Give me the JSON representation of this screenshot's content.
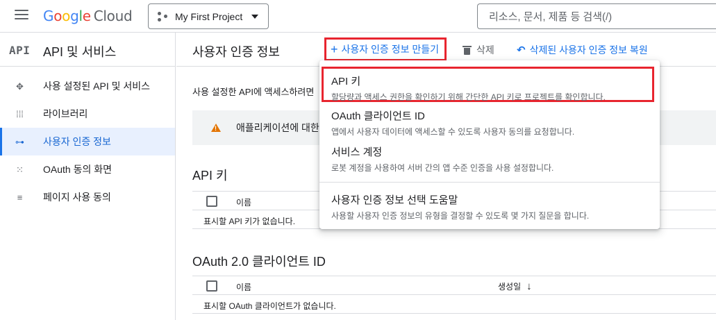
{
  "header": {
    "logo_letters": [
      "G",
      "o",
      "o",
      "g",
      "l",
      "e"
    ],
    "logo_suffix": "Cloud",
    "project_name": "My First Project",
    "search_placeholder": "리소스, 문서, 제품 등 검색(/)"
  },
  "sidebar": {
    "badge": "API",
    "title": "API 및 서비스",
    "items": [
      {
        "label": "사용 설정된 API 및 서비스",
        "icon": "dashboard-icon"
      },
      {
        "label": "라이브러리",
        "icon": "library-icon"
      },
      {
        "label": "사용자 인증 정보",
        "icon": "key-icon",
        "active": true
      },
      {
        "label": "OAuth 동의 화면",
        "icon": "oauth-icon"
      },
      {
        "label": "페이지 사용 동의",
        "icon": "page-settings-icon"
      }
    ]
  },
  "main": {
    "title": "사용자 인증 정보",
    "create_label": "사용자 인증 정보 만들기",
    "delete_label": "삭제",
    "restore_label": "삭제된 사용자 인증 정보 복원",
    "intro": "사용 설정한 API에 액세스하려면",
    "warning": "애플리케이션에 대한",
    "api_keys": {
      "title": "API 키",
      "col_name": "이름",
      "empty": "표시할 API 키가 없습니다."
    },
    "oauth": {
      "title": "OAuth 2.0 클라이언트 ID",
      "col_name": "이름",
      "col_created": "생성일",
      "empty": "표시할 OAuth 클라이언트가 없습니다."
    }
  },
  "menu": {
    "items": [
      {
        "title": "API 키",
        "desc": "할당량과 액세스 권한을 확인하기 위해 간단한 API 키로 프로젝트를 확인합니다."
      },
      {
        "title": "OAuth 클라이언트 ID",
        "desc": "앱에서 사용자 데이터에 액세스할 수 있도록 사용자 동의를 요청합니다."
      },
      {
        "title": "서비스 계정",
        "desc": "로봇 계정을 사용하여 서버 간의 앱 수준 인증을 사용 설정합니다."
      },
      {
        "title": "사용자 인증 정보 선택 도움말",
        "desc": "사용할 사용자 인증 정보의 유형을 결정할 수 있도록 몇 가지 질문을 합니다."
      }
    ]
  },
  "colors": {
    "accent": "#1a73e8",
    "highlight_outline": "#e8252f",
    "warning": "#e37400"
  }
}
